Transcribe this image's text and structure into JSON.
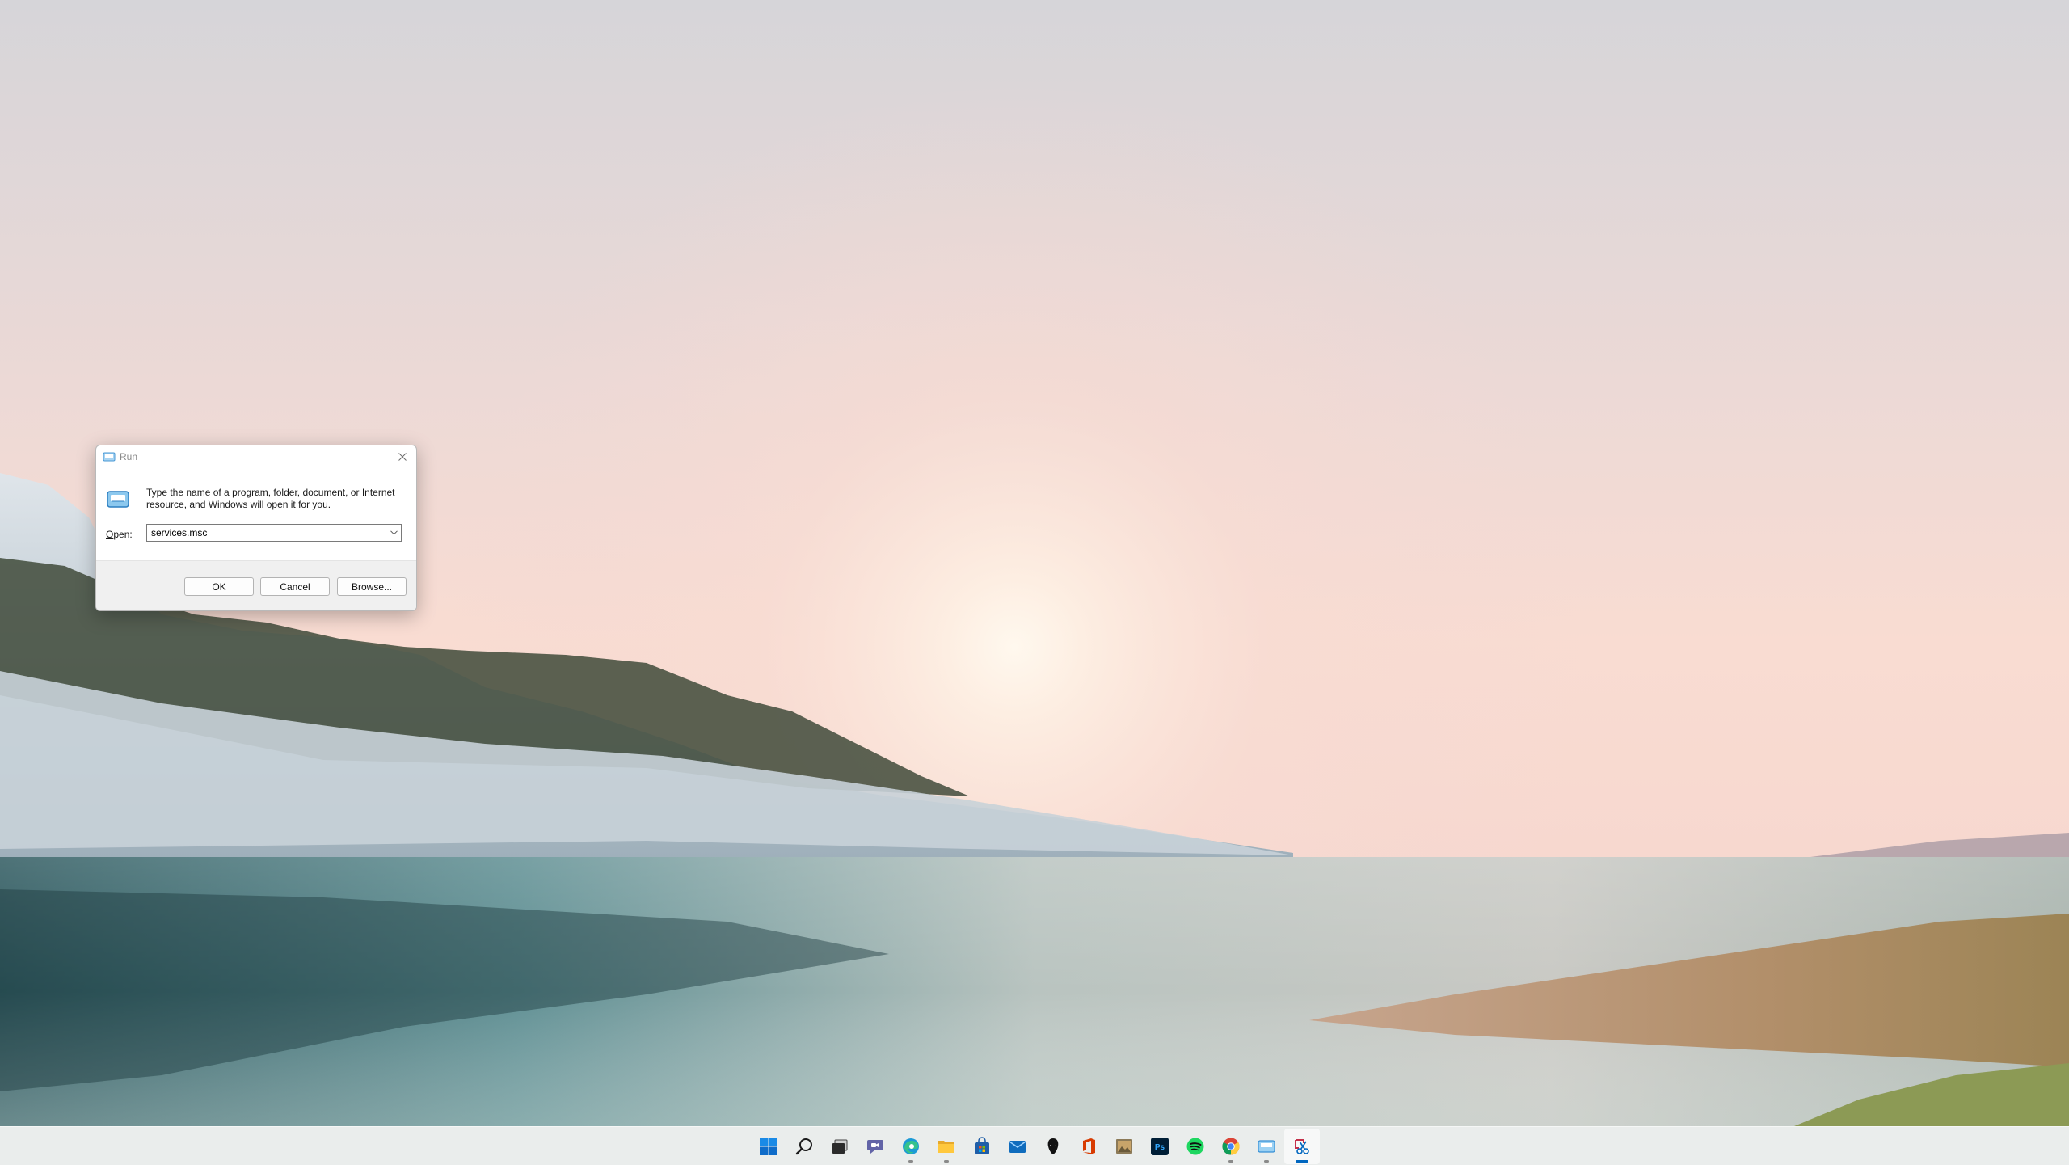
{
  "run_dialog": {
    "title": "Run",
    "description": "Type the name of a program, folder, document, or Internet resource, and Windows will open it for you.",
    "open_label_accel": "O",
    "open_label_rest": "pen:",
    "open_value": "services.msc",
    "ok_label": "OK",
    "cancel_label": "Cancel",
    "browse_label": "Browse..."
  },
  "taskbar": {
    "apps": [
      {
        "name": "start-button",
        "icon": "windows-logo-icon",
        "running": false
      },
      {
        "name": "search-button",
        "icon": "search-icon",
        "running": false
      },
      {
        "name": "task-view-button",
        "icon": "task-view-icon",
        "running": false
      },
      {
        "name": "chat-button",
        "icon": "teams-chat-icon",
        "running": false
      },
      {
        "name": "edge-button",
        "icon": "edge-icon",
        "running": true
      },
      {
        "name": "file-explorer-button",
        "icon": "folder-icon",
        "running": true
      },
      {
        "name": "store-button",
        "icon": "store-icon",
        "running": false
      },
      {
        "name": "mail-button",
        "icon": "mail-icon",
        "running": false
      },
      {
        "name": "alienware-button",
        "icon": "alienware-icon",
        "running": false
      },
      {
        "name": "office-button",
        "icon": "office-icon",
        "running": false
      },
      {
        "name": "photo-app-button",
        "icon": "photo-icon",
        "running": false
      },
      {
        "name": "photoshop-button",
        "icon": "photoshop-icon",
        "running": false
      },
      {
        "name": "spotify-button",
        "icon": "spotify-icon",
        "running": false
      },
      {
        "name": "chrome-button",
        "icon": "chrome-icon",
        "running": true
      },
      {
        "name": "run-taskbar-button",
        "icon": "run-icon",
        "running": true
      },
      {
        "name": "snipping-tool-button",
        "icon": "snipping-tool-icon",
        "running": true,
        "active": true
      }
    ],
    "photoshop_text": "Ps"
  },
  "colors": {
    "accent": "#0067c0",
    "sky_top": "#d8d6da",
    "sun_glow": "#fce8dc",
    "water": "#6d9aa0"
  }
}
